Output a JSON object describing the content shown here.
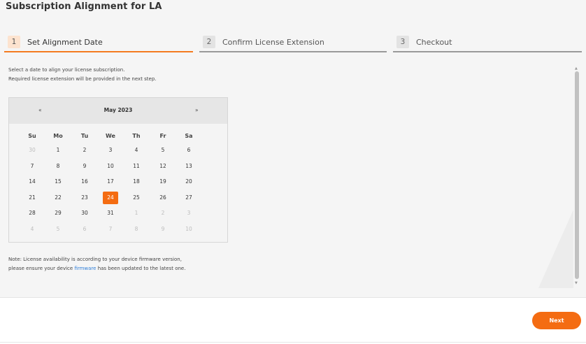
{
  "page": {
    "title": "Subscription Alignment for LA"
  },
  "steps": [
    {
      "num": "1",
      "label": "Set Alignment Date",
      "active": true
    },
    {
      "num": "2",
      "label": "Confirm License Extension",
      "active": false
    },
    {
      "num": "3",
      "label": "Checkout",
      "active": false
    }
  ],
  "intro": {
    "line1": "Select a date to align your license subscription.",
    "line2": "Required license extension will be provided in the next step."
  },
  "calendar": {
    "month": "May 2023",
    "prev": "«",
    "next": "»",
    "weekdays": [
      "Su",
      "Mo",
      "Tu",
      "We",
      "Th",
      "Fr",
      "Sa"
    ],
    "weeks": [
      [
        {
          "d": "30",
          "m": true
        },
        {
          "d": "1"
        },
        {
          "d": "2"
        },
        {
          "d": "3"
        },
        {
          "d": "4"
        },
        {
          "d": "5"
        },
        {
          "d": "6"
        }
      ],
      [
        {
          "d": "7"
        },
        {
          "d": "8"
        },
        {
          "d": "9"
        },
        {
          "d": "10"
        },
        {
          "d": "11"
        },
        {
          "d": "12"
        },
        {
          "d": "13"
        }
      ],
      [
        {
          "d": "14"
        },
        {
          "d": "15"
        },
        {
          "d": "16"
        },
        {
          "d": "17"
        },
        {
          "d": "18"
        },
        {
          "d": "19"
        },
        {
          "d": "20"
        }
      ],
      [
        {
          "d": "21"
        },
        {
          "d": "22"
        },
        {
          "d": "23"
        },
        {
          "d": "24",
          "s": true
        },
        {
          "d": "25"
        },
        {
          "d": "26"
        },
        {
          "d": "27"
        }
      ],
      [
        {
          "d": "28"
        },
        {
          "d": "29"
        },
        {
          "d": "30"
        },
        {
          "d": "31"
        },
        {
          "d": "1",
          "m": true
        },
        {
          "d": "2",
          "m": true
        },
        {
          "d": "3",
          "m": true
        }
      ],
      [
        {
          "d": "4",
          "m": true
        },
        {
          "d": "5",
          "m": true
        },
        {
          "d": "6",
          "m": true
        },
        {
          "d": "7",
          "m": true
        },
        {
          "d": "8",
          "m": true
        },
        {
          "d": "9",
          "m": true
        },
        {
          "d": "10",
          "m": true
        }
      ]
    ],
    "selected_date": "24"
  },
  "note": {
    "line1": "Note: License availability is according to your device firmware version,",
    "line2_before": "please ensure your device ",
    "link": "firmware",
    "line2_after": " has been updated to the latest one."
  },
  "footer": {
    "next_label": "Next"
  },
  "colors": {
    "accent": "#f46c12",
    "link": "#2f7ed8"
  }
}
